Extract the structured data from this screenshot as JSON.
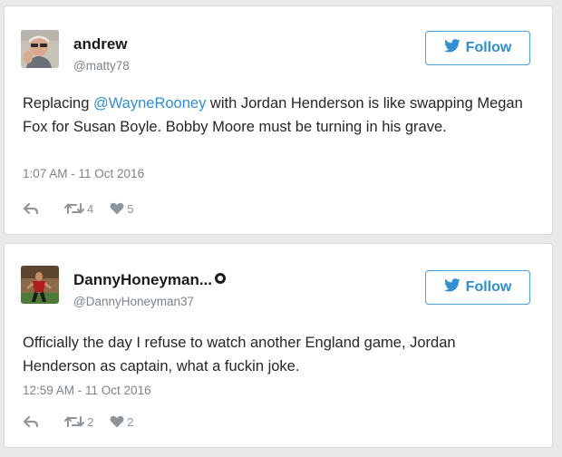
{
  "colors": {
    "accent": "#2f8fd2",
    "follow_border": "#4aa3df",
    "text": "#262626",
    "muted": "#7b848c",
    "background": "#e9e9e9"
  },
  "tweets": [
    {
      "display_name": "andrew",
      "handle": "@matty78",
      "verified": false,
      "follow_label": "Follow",
      "text_before": "Replacing ",
      "mention": "@WayneRooney",
      "text_after": " with Jordan Henderson is like swapping Megan Fox for Susan Boyle. Bobby Moore must be turning in his grave.",
      "timestamp": "1:07 AM - 11 Oct 2016",
      "retweets": "4",
      "likes": "5",
      "icons": [
        "twitter-bird-icon",
        "reply-icon",
        "retweet-icon",
        "heart-icon"
      ]
    },
    {
      "display_name": "DannyHoneyman...",
      "handle": "@DannyHoneyman37",
      "verified": true,
      "follow_label": "Follow",
      "text": "Officially the day I refuse to watch another England game, Jordan Henderson as captain, what a fuckin joke.",
      "timestamp": "12:59 AM - 11 Oct 2016",
      "retweets": "2",
      "likes": "2",
      "icons": [
        "twitter-bird-icon",
        "reply-icon",
        "retweet-icon",
        "heart-icon"
      ]
    }
  ]
}
